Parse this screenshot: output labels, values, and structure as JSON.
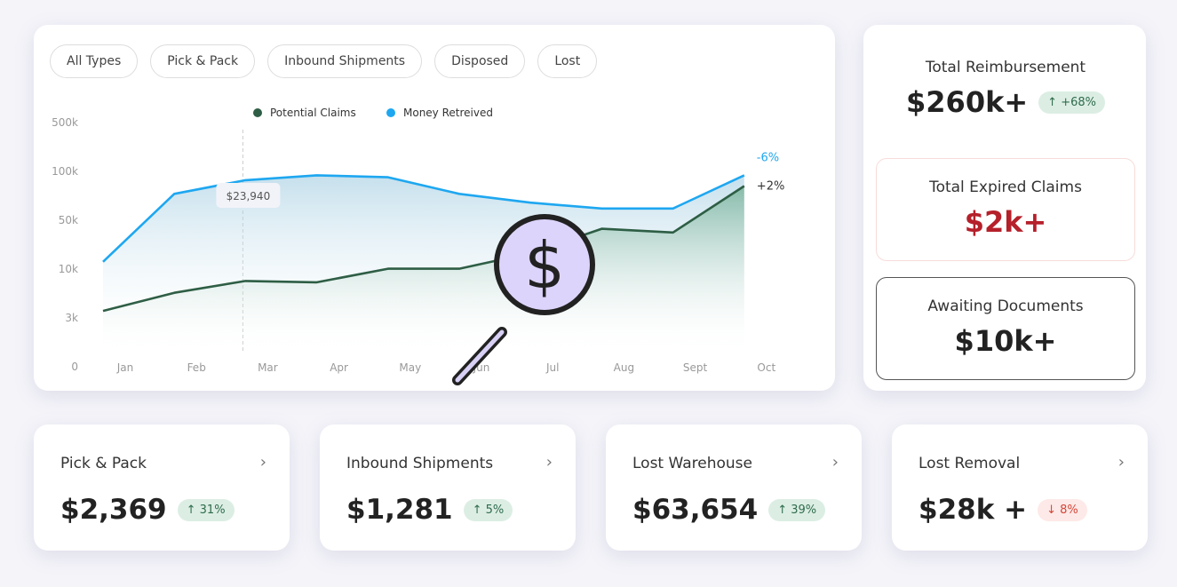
{
  "filters": [
    {
      "label": "All Types",
      "active": true
    },
    {
      "label": "Pick & Pack"
    },
    {
      "label": "Inbound Shipments"
    },
    {
      "label": "Disposed"
    },
    {
      "label": "Lost"
    }
  ],
  "chart_data": {
    "type": "line",
    "categories": [
      "Jan",
      "Feb",
      "Mar",
      "Apr",
      "May",
      "Jun",
      "Jul",
      "Aug",
      "Sept",
      "Oct"
    ],
    "y_ticks": [
      "0",
      "3k",
      "10k",
      "50k",
      "100k",
      "500k"
    ],
    "y_tick_values": [
      0,
      3000,
      10000,
      50000,
      100000,
      500000
    ],
    "series": [
      {
        "name": "Potential Claims",
        "color": "#2e5e45",
        "values": [
          4000,
          6600,
          8300,
          8100,
          10300,
          10300,
          23000,
          43000,
          40000,
          85000
        ],
        "end_label": "+2%"
      },
      {
        "name": "Money Retreived",
        "color": "#1ea7f0",
        "values": [
          16000,
          77000,
          91000,
          96000,
          94000,
          77000,
          68000,
          62000,
          62000,
          96000
        ],
        "end_label": "-6%"
      }
    ],
    "tooltip": {
      "label": "$23,940",
      "month": "Mar"
    },
    "legend": "top-center",
    "grid": false
  },
  "summary": [
    {
      "title": "Total Reimbursement",
      "value": "$260k+",
      "badge": "↑ +68%",
      "bg": "#fdf9ea",
      "color": "#222"
    },
    {
      "title": "Total Expired Claims",
      "value": "$2k+",
      "bg": "#fdf0ef",
      "color": "#b5202a"
    },
    {
      "title": "Awaiting Documents",
      "value": "$10k+",
      "bg": "#ffffff",
      "color": "#222"
    }
  ],
  "kpis": [
    {
      "title": "Pick & Pack",
      "value": "$2,369",
      "badge": "↑ 31%",
      "dir": "up"
    },
    {
      "title": "Inbound Shipments",
      "value": "$1,281",
      "badge": "↑ 5%",
      "dir": "up"
    },
    {
      "title": "Lost Warehouse",
      "value": "$63,654",
      "badge": "↑ 39%",
      "dir": "up"
    },
    {
      "title": "Lost Removal",
      "value": "$28k +",
      "badge": "↓ 8%",
      "dir": "down"
    }
  ],
  "icons": {
    "magnifier": "dollar-magnifier-icon",
    "chevron": "›"
  }
}
